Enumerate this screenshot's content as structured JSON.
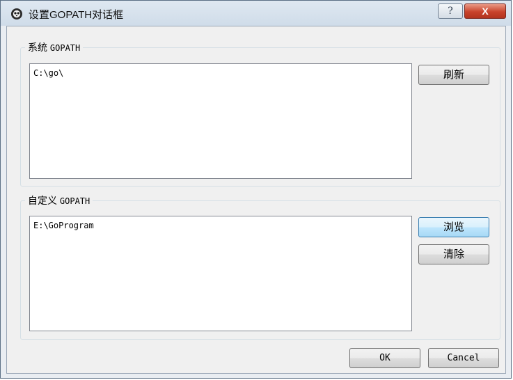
{
  "window": {
    "title": "设置GOPATH对话框",
    "help_label": "?",
    "close_label": "X"
  },
  "system_group": {
    "prefix": "系统",
    "label_suffix": "GOPATH",
    "items": [
      "C:\\go\\"
    ],
    "refresh_button": "刷新"
  },
  "custom_group": {
    "prefix": "自定义",
    "label_suffix": "GOPATH",
    "items": [
      "E:\\GoProgram"
    ],
    "browse_button": "浏览",
    "clear_button": "清除"
  },
  "footer": {
    "ok_button": "OK",
    "cancel_button": "Cancel"
  },
  "colors": {
    "titlebar": "#d6e2ee",
    "close_button": "#c8432c",
    "focus_border": "#3c7fb1"
  }
}
